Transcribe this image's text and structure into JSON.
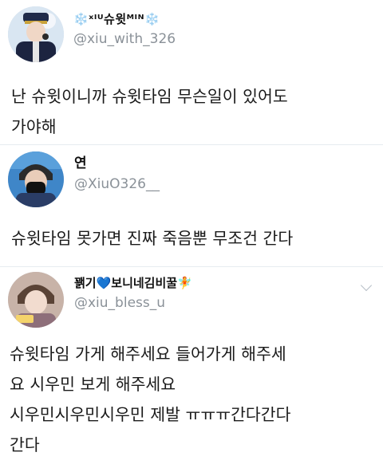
{
  "tweets": [
    {
      "name": "❄️ˣᴵᵁ슈윗ᴹᴵᴺ❄️",
      "handle": "@xiu_with_326",
      "text": "난 슈윗이니까 슈윗타임 무슨일이 있어도\n가야해"
    },
    {
      "name": "연",
      "handle": "@XiuO326__",
      "text": "슈윗타임 못가면 진짜 죽음뿐 무조건 간다"
    },
    {
      "name": "꽭기💙보니네김비꿀🧚",
      "handle": "@xiu_bless_u",
      "text": "슈윗타임 가게 해주세요 들어가게 해주세\n요 시우민 보게 해주세요\n시우민시우민시우민 제발 ㅠㅠㅠ간다간다\n간다"
    }
  ]
}
